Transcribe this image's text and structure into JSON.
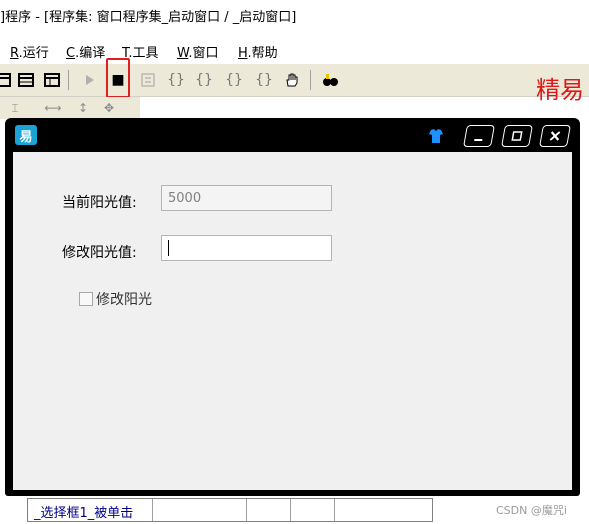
{
  "ide": {
    "title": "]程序 - [程序集: 窗口程序集_启动窗口 / _启动窗口]",
    "menu": [
      {
        "key": "R",
        "label": ".运行"
      },
      {
        "key": "C",
        "label": ".编译"
      },
      {
        "key": "T",
        "label": ".工具"
      },
      {
        "key": "W",
        "label": ".窗口"
      },
      {
        "key": "H",
        "label": ".帮助"
      }
    ],
    "toolbar": {
      "stop_glyph": "■",
      "brand_text": "精易"
    }
  },
  "dialog": {
    "app_icon_glyph": "易",
    "current_label": "当前阳光值:",
    "current_value": "5000",
    "modify_label": "修改阳光值:",
    "modify_value": "",
    "checkbox_label": "修改阳光",
    "checkbox_checked": false
  },
  "bottom": {
    "event_name": "_选择框1_被单击"
  },
  "watermark": "CSDN @魔咒i"
}
